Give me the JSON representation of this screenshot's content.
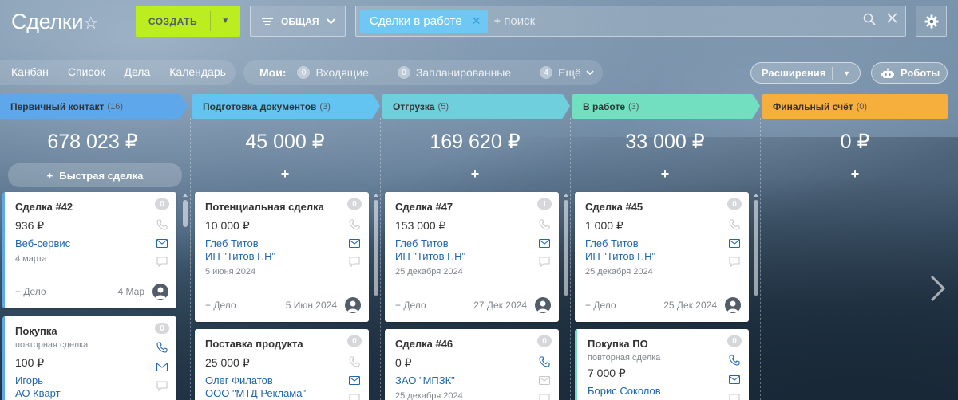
{
  "header": {
    "title": "Сделки",
    "create_label": "СОЗДАТЬ",
    "filter_label": "ОБЩАЯ",
    "search_chip": "Сделки в работе",
    "search_placeholder": "поиск"
  },
  "views": [
    "Канбан",
    "Список",
    "Дела",
    "Календарь"
  ],
  "mine": {
    "label": "Мои:",
    "items": [
      {
        "count": "0",
        "label": "Входящие"
      },
      {
        "count": "0",
        "label": "Запланированные"
      },
      {
        "count": "4",
        "label": "Ещё"
      }
    ]
  },
  "actions": {
    "extensions": "Расширения",
    "robots": "Роботы"
  },
  "quick_deal": "Быстрая сделка",
  "add_activity": "+ Дело",
  "columns": [
    {
      "name": "Первичный контакт",
      "count": "(16)",
      "sum": "678 023 ₽",
      "color": "#3bc8f5"
    },
    {
      "name": "Подготовка документов",
      "count": "(3)",
      "sum": "45 000 ₽",
      "color": "#6fc8f4"
    },
    {
      "name": "Отгрузка",
      "count": "(5)",
      "sum": "169 620 ₽",
      "color": "#6bd3d3"
    },
    {
      "name": "В работе",
      "count": "(3)",
      "sum": "33 000 ₽",
      "color": "#71e4b8"
    },
    {
      "name": "Финальный счёт",
      "count": "(0)",
      "sum": "0 ₽",
      "color": "#f6ae3c"
    }
  ],
  "cards": {
    "c0a": {
      "title": "Сделка #42",
      "price": "936 ₽",
      "link": "Веб-сервис",
      "date": "4 марта",
      "foot_date": "4 Мар",
      "badge": "0"
    },
    "c0b": {
      "title": "Покупка",
      "subtitle": "повторная сделка",
      "price": "100 ₽",
      "link": "Игорь",
      "link2": "АО Кварт",
      "badge": "0"
    },
    "c1a": {
      "title": "Потенциальная сделка",
      "price": "10 000 ₽",
      "link": "Глеб Титов",
      "link2": "ИП \"Титов Г.Н\"",
      "date": "5 июня 2024",
      "foot_date": "5 Июн 2024",
      "badge": "0"
    },
    "c1b": {
      "title": "Поставка продукта",
      "price": "25 000 ₽",
      "link": "Олег Филатов",
      "link2": "ООО \"МТД Реклама\"",
      "badge": "0"
    },
    "c2a": {
      "title": "Сделка #47",
      "price": "153 000 ₽",
      "link": "Глеб Титов",
      "link2": "ИП \"Титов Г.Н\"",
      "date": "25 декабря 2024",
      "foot_date": "27 Дек 2024",
      "badge": "1"
    },
    "c2b": {
      "title": "Сделка #46",
      "price": "0 ₽",
      "link": "ЗАО \"МПЗК\"",
      "date": "25 декабря 2024",
      "badge": "0"
    },
    "c3a": {
      "title": "Сделка #45",
      "price": "1 000 ₽",
      "link": "Глеб Титов",
      "link2": "ИП \"Титов Г.Н\"",
      "date": "25 декабря 2024",
      "foot_date": "25 Дек 2024",
      "badge": "0"
    },
    "c3b": {
      "title": "Покупка ПО",
      "subtitle": "повторная сделка",
      "price": "7 000 ₽",
      "link": "Борис Соколов",
      "badge": "0"
    }
  },
  "colors": {
    "create": "#bbed21",
    "link": "#2067b0",
    "chip": "#6fc8f4"
  }
}
